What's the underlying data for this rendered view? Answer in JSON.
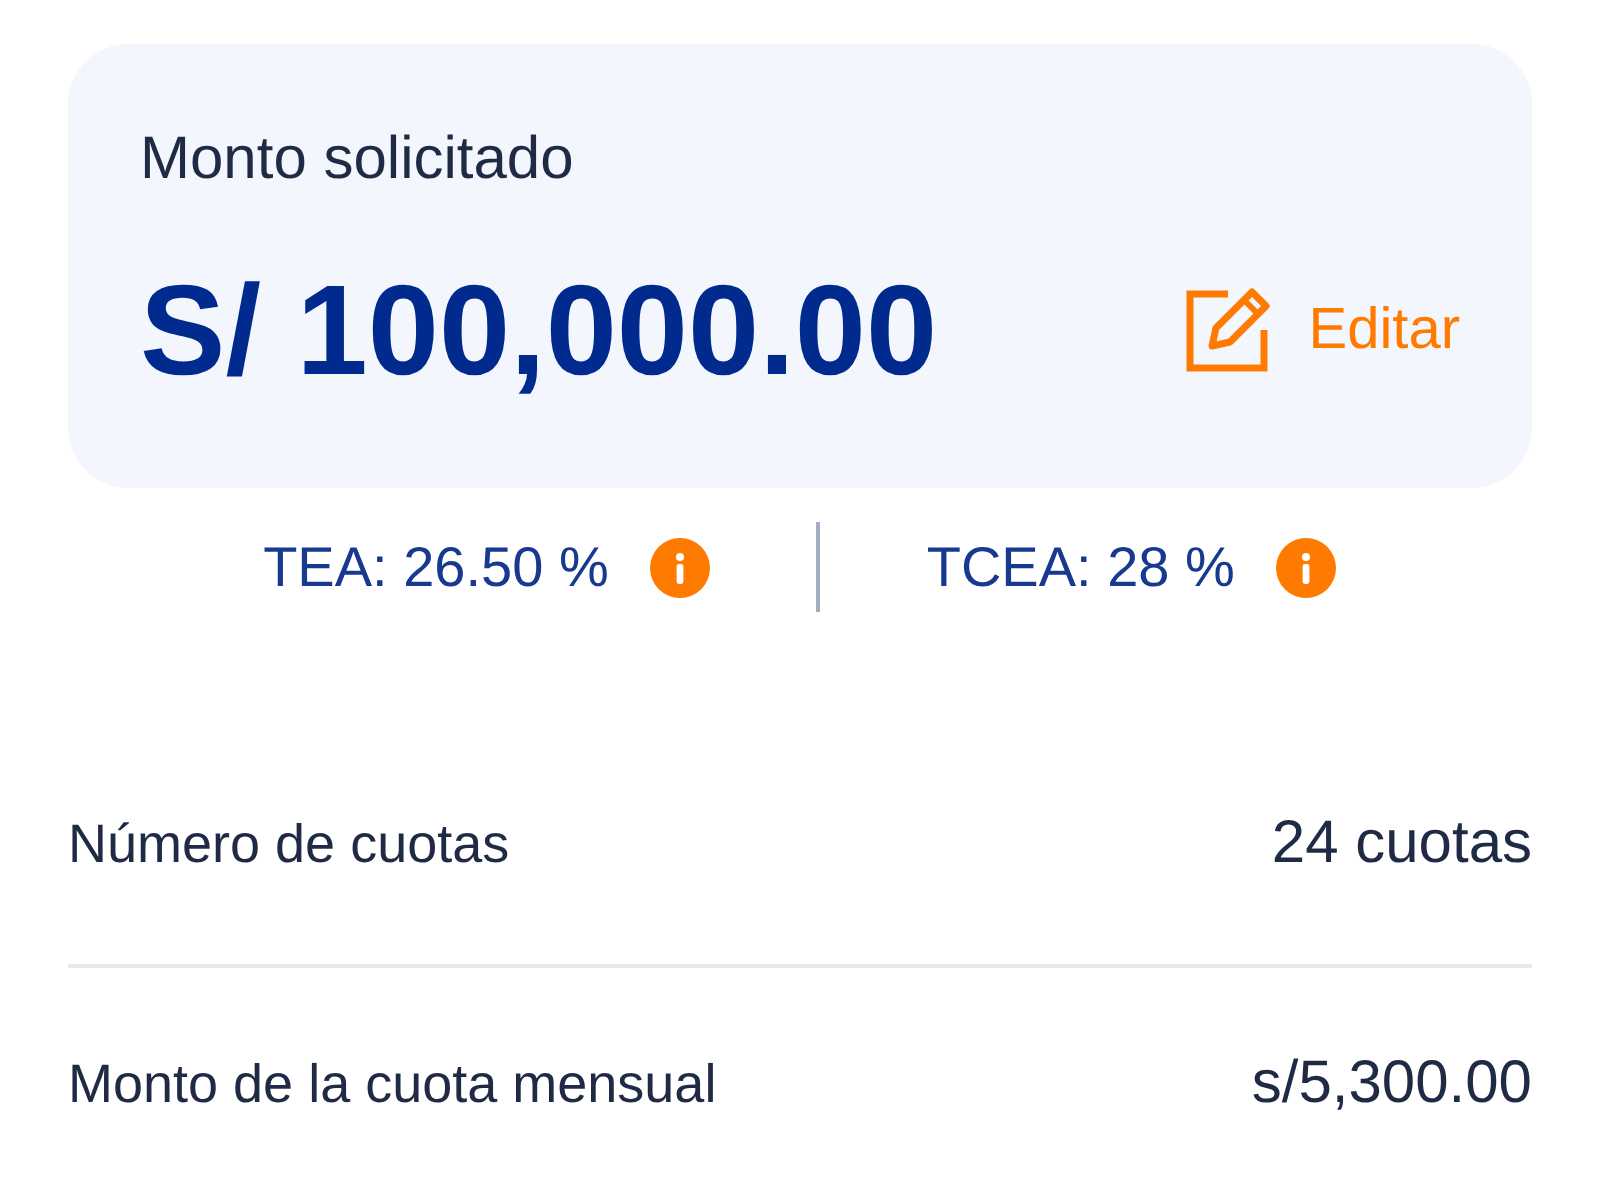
{
  "card": {
    "label": "Monto solicitado",
    "amount": "S/ 100,000.00",
    "edit_button": "Editar"
  },
  "rates": [
    {
      "label": "TEA: 26.50 %"
    },
    {
      "label": "TCEA: 28 %"
    }
  ],
  "details": [
    {
      "label": "Número de cuotas",
      "value": "24 cuotas"
    },
    {
      "label": "Monto de la cuota mensual",
      "value": "s/5,300.00"
    }
  ]
}
